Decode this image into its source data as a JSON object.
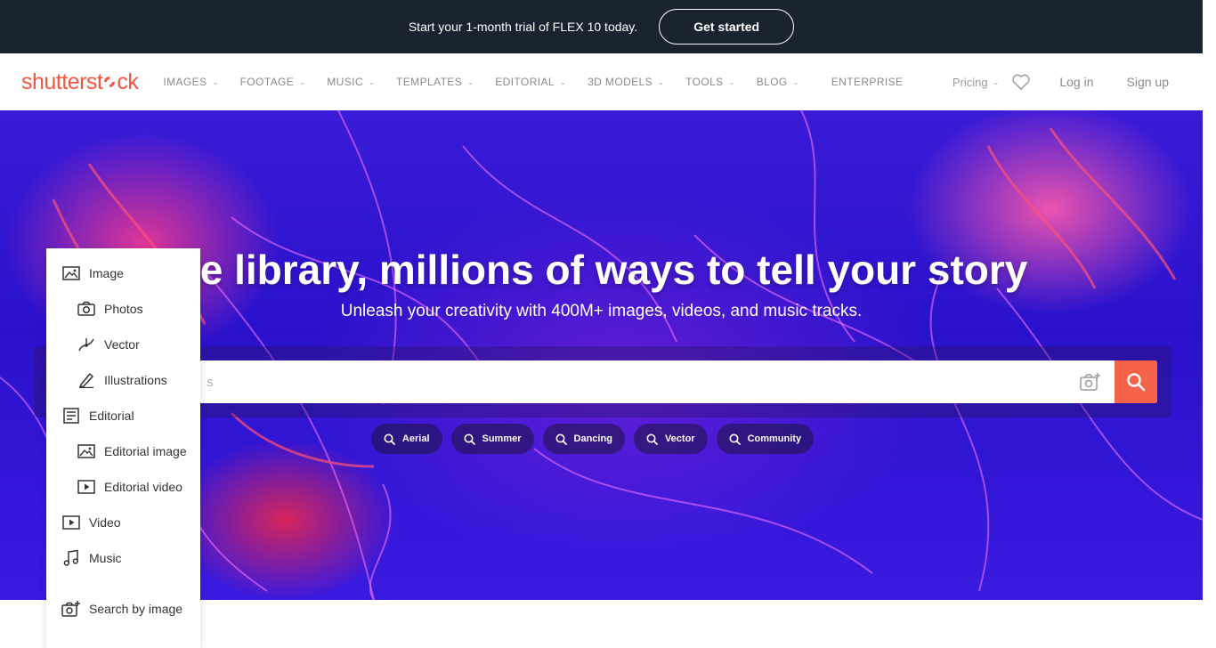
{
  "promo": {
    "text": "Start your 1-month trial of FLEX 10 today.",
    "button": "Get started"
  },
  "header": {
    "logo_left": "shutterst",
    "logo_right": "ck",
    "nav": [
      {
        "label": "IMAGES"
      },
      {
        "label": "FOOTAGE"
      },
      {
        "label": "MUSIC"
      },
      {
        "label": "TEMPLATES"
      },
      {
        "label": "EDITORIAL"
      },
      {
        "label": "3D MODELS"
      },
      {
        "label": "TOOLS"
      },
      {
        "label": "BLOG"
      },
      {
        "label": "ENTERPRISE"
      }
    ],
    "pricing": "Pricing",
    "login": "Log in",
    "signup": "Sign up",
    "brand_color": "#f5543e"
  },
  "hero": {
    "headline": "ne library, millions of ways to tell your story",
    "subline": "Unleash your creativity with 400M+ images, videos, and music tracks.",
    "search_placeholder": "s",
    "search_button_color": "#f5634b",
    "chips": [
      "Aerial",
      "Summer",
      "Dancing",
      "Vector",
      "Community"
    ]
  },
  "menu": {
    "items": [
      {
        "label": "Image",
        "icon": "image-icon"
      },
      {
        "label": "Photos",
        "icon": "camera-icon"
      },
      {
        "label": "Vector",
        "icon": "vector-icon"
      },
      {
        "label": "Illustrations",
        "icon": "pen-icon"
      },
      {
        "label": "Editorial",
        "icon": "document-icon"
      },
      {
        "label": "Editorial image",
        "icon": "image-icon"
      },
      {
        "label": "Editorial video",
        "icon": "play-icon"
      },
      {
        "label": "Video",
        "icon": "play-icon"
      },
      {
        "label": "Music",
        "icon": "music-note-icon"
      },
      {
        "label": "Search by image",
        "icon": "camera-plus-icon"
      }
    ]
  }
}
